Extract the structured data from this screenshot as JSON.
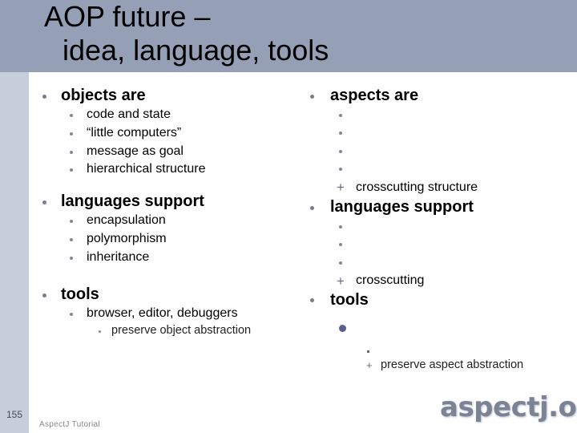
{
  "slide": {
    "title_line1": "AOP future –",
    "title_line2": "idea, language, tools",
    "slide_number": "155",
    "footer": "AspectJ Tutorial",
    "logo_text": "aspectj.org",
    "colors": {
      "title_bar": "#959fb5",
      "sidebar": "#c6cddb",
      "bullet": "#7a7a90"
    }
  },
  "left": {
    "objects": {
      "heading": "objects are",
      "items": [
        "code and state",
        "“little computers”",
        "message as goal",
        "hierarchical structure"
      ]
    },
    "languages": {
      "heading": "languages support",
      "items": [
        "encapsulation",
        "polymorphism",
        "inheritance"
      ]
    },
    "tools": {
      "heading": "tools",
      "item": "browser, editor, debuggers",
      "subitem": "preserve object abstraction"
    }
  },
  "right": {
    "aspects": {
      "heading": "aspects are",
      "items": [
        "",
        "",
        "",
        ""
      ],
      "plus_item": "crosscutting structure"
    },
    "languages": {
      "heading": "languages support",
      "items": [
        "",
        "",
        ""
      ],
      "plus_item": "crosscutting"
    },
    "tools": {
      "heading": "tools",
      "item": "",
      "subitem": "",
      "plus_item": "preserve aspect abstraction"
    }
  }
}
